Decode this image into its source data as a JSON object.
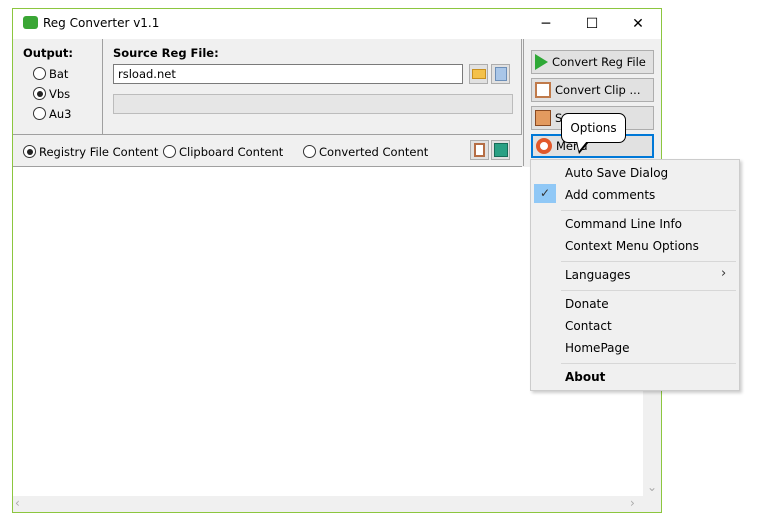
{
  "window": {
    "title": "Reg Converter v1.1",
    "minimize": "─",
    "maximize": "☐",
    "close": "✕"
  },
  "output": {
    "label": "Output:",
    "options": [
      "Bat",
      "Vbs",
      "Au3"
    ],
    "selected": "Vbs"
  },
  "source": {
    "label": "Source Reg File:",
    "value": "rsload.net"
  },
  "view": {
    "options": [
      "Registry File Content",
      "Clipboard Content",
      "Converted Content"
    ],
    "selected": "Registry File Content"
  },
  "buttons": {
    "convert_reg": "Convert Reg File",
    "convert_clip": "Convert Clip ...",
    "save": "Save",
    "menu": "Menu"
  },
  "tooltip": "Options",
  "menu": {
    "items": [
      "Auto Save Dialog",
      "Add comments",
      "Command Line Info",
      "Context Menu Options",
      "Languages",
      "Donate",
      "Contact",
      "HomePage",
      "About"
    ],
    "checked": "Add comments",
    "submenu_arrow": "›"
  },
  "scrollbar": {
    "down": "⌄",
    "right": "›"
  }
}
